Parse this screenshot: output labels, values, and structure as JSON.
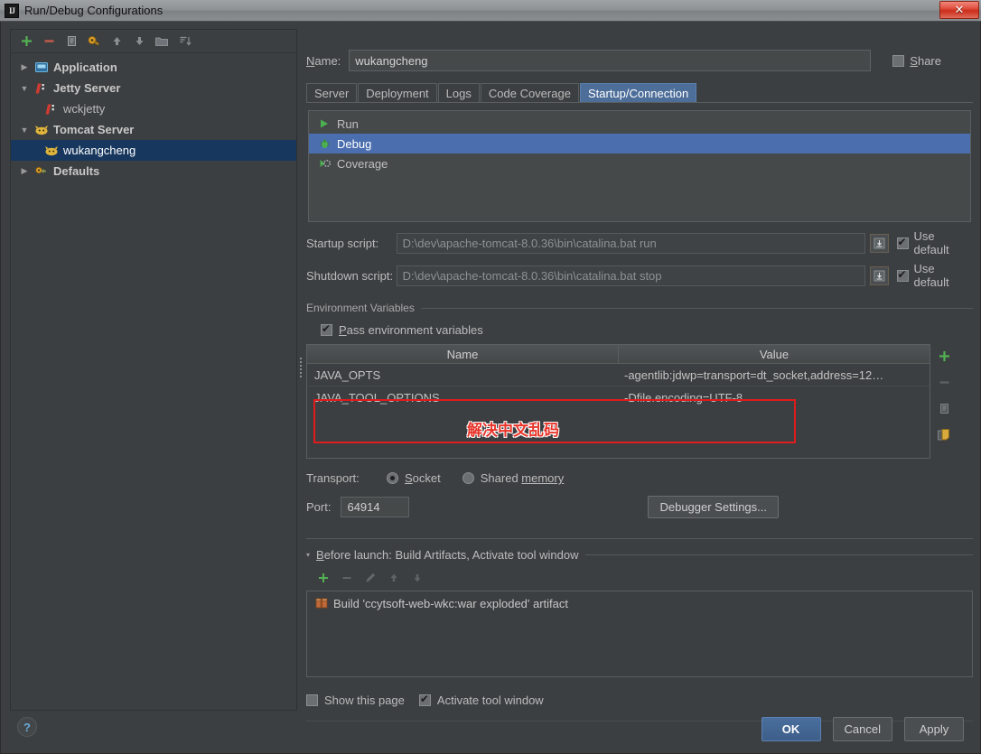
{
  "window": {
    "title": "Run/Debug Configurations",
    "app_icon": "IJ",
    "close_label": "✕"
  },
  "left_panel": {
    "toolbar": [
      {
        "name": "add-configuration-button",
        "icon": "plus-icon",
        "label": "+"
      },
      {
        "name": "remove-configuration-button",
        "icon": "minus-icon",
        "label": "−"
      },
      {
        "name": "copy-configuration-button",
        "icon": "copy-icon",
        "label": "Copy"
      },
      {
        "name": "save-configuration-button",
        "icon": "wrench-icon",
        "label": "Save"
      },
      {
        "name": "move-up-button",
        "icon": "arrow-up-icon",
        "label": "Up"
      },
      {
        "name": "move-down-button",
        "icon": "arrow-down-icon",
        "label": "Down"
      },
      {
        "name": "move-into-folder-button",
        "icon": "folder-icon",
        "label": "Folder"
      },
      {
        "name": "sort-configurations-button",
        "icon": "sort-icon",
        "label": "Sort"
      }
    ],
    "tree": [
      {
        "label": "Application",
        "twisty": "▶",
        "icon": "application-icon",
        "depth": 0,
        "bold": true,
        "selected": false
      },
      {
        "label": "Jetty Server",
        "twisty": "▼",
        "icon": "jetty-icon",
        "depth": 0,
        "bold": true,
        "selected": false
      },
      {
        "label": "wckjetty",
        "twisty": "",
        "icon": "jetty-icon",
        "depth": 1,
        "bold": false,
        "selected": false
      },
      {
        "label": "Tomcat Server",
        "twisty": "▼",
        "icon": "tomcat-icon",
        "depth": 0,
        "bold": true,
        "selected": false
      },
      {
        "label": "wukangcheng",
        "twisty": "",
        "icon": "tomcat-icon",
        "depth": 1,
        "bold": false,
        "selected": true
      },
      {
        "label": "Defaults",
        "twisty": "▶",
        "icon": "defaults-icon",
        "depth": 0,
        "bold": true,
        "selected": false
      }
    ],
    "help_label": "?"
  },
  "name_row": {
    "label_prefix": "N",
    "label_rest": "ame:",
    "value": "wukangcheng",
    "share_prefix": "S",
    "share_rest": "hare",
    "share_checked": false
  },
  "tabs": [
    {
      "label": "Server",
      "active": false
    },
    {
      "label": "Deployment",
      "active": false
    },
    {
      "label": "Logs",
      "active": false
    },
    {
      "label": "Code Coverage",
      "active": false
    },
    {
      "label": "Startup/Connection",
      "active": true
    }
  ],
  "rdc_list": [
    {
      "label": "Run",
      "icon": "run-green-triangle-icon",
      "selected": false
    },
    {
      "label": "Debug",
      "icon": "debug-bug-icon",
      "selected": true
    },
    {
      "label": "Coverage",
      "icon": "coverage-icon",
      "selected": false
    }
  ],
  "scripts": [
    {
      "label": "Startup script:",
      "value": "D:\\dev\\apache-tomcat-8.0.36\\bin\\catalina.bat run",
      "use_default_label": "Use default",
      "use_default_checked": true
    },
    {
      "label": "Shutdown script:",
      "value": "D:\\dev\\apache-tomcat-8.0.36\\bin\\catalina.bat stop",
      "use_default_label": "Use default",
      "use_default_checked": true
    }
  ],
  "env_section": {
    "group_title": "Environment Variables",
    "pass_env_prefix": "P",
    "pass_env_rest": "ass environment variables",
    "pass_env_checked": true,
    "columns": [
      "Name",
      "Value"
    ],
    "rows": [
      {
        "name": "JAVA_OPTS",
        "value": "-agentlib:jdwp=transport=dt_socket,address=12…"
      },
      {
        "name": "JAVA_TOOL_OPTIONS",
        "value": "-Dfile.encoding=UTF-8"
      }
    ],
    "side_buttons": [
      {
        "name": "add-env-var-button",
        "icon": "plus-icon"
      },
      {
        "name": "remove-env-var-button",
        "icon": "minus-icon"
      },
      {
        "name": "copy-env-var-button",
        "icon": "copy-icon"
      },
      {
        "name": "paste-env-var-button",
        "icon": "paste-icon"
      }
    ],
    "annotation": {
      "text": "解决中文乱码",
      "color": "#e8342a",
      "box_color": "#e01b1b"
    }
  },
  "transport": {
    "label": "Transport:",
    "options": [
      {
        "prefix": "S",
        "rest": "ocket",
        "selected": true
      },
      {
        "prefix": "Shared ",
        "rest": "memory",
        "mnemonic": "m",
        "selected": false
      }
    ]
  },
  "port": {
    "label": "Port:",
    "value": "64914",
    "debugger_settings_label": "Debugger Settings..."
  },
  "before_launch": {
    "twisty": "▾",
    "title_prefix": "B",
    "title_rest": "efore launch: Build Artifacts, Activate tool window",
    "toolbar": [
      {
        "name": "add-task-button",
        "icon": "plus-icon"
      },
      {
        "name": "remove-task-button",
        "icon": "minus-icon"
      },
      {
        "name": "edit-task-button",
        "icon": "pencil-icon"
      },
      {
        "name": "move-task-up-button",
        "icon": "arrow-up-icon"
      },
      {
        "name": "move-task-down-button",
        "icon": "arrow-down-icon"
      }
    ],
    "items": [
      {
        "label": "Build 'ccytsoft-web-wkc:war exploded' artifact",
        "icon": "artifact-icon"
      }
    ]
  },
  "bottom_checks": [
    {
      "label": "Show this page",
      "checked": false,
      "name": "show-this-page-checkbox"
    },
    {
      "label": "Activate tool window",
      "checked": true,
      "name": "activate-tool-window-checkbox"
    }
  ],
  "dialog_buttons": [
    {
      "label": "OK",
      "primary": true,
      "name": "ok-button"
    },
    {
      "label": "Cancel",
      "primary": false,
      "name": "cancel-button"
    },
    {
      "label": "Apply",
      "primary": false,
      "name": "apply-button",
      "mnemonic": "A"
    }
  ],
  "colors": {
    "background": "#3c3f41",
    "selection_blue": "#4b6eaf",
    "tree_selection": "#17375e",
    "accent_green": "#4f9c4f",
    "annotation_red": "#e01b1b"
  }
}
